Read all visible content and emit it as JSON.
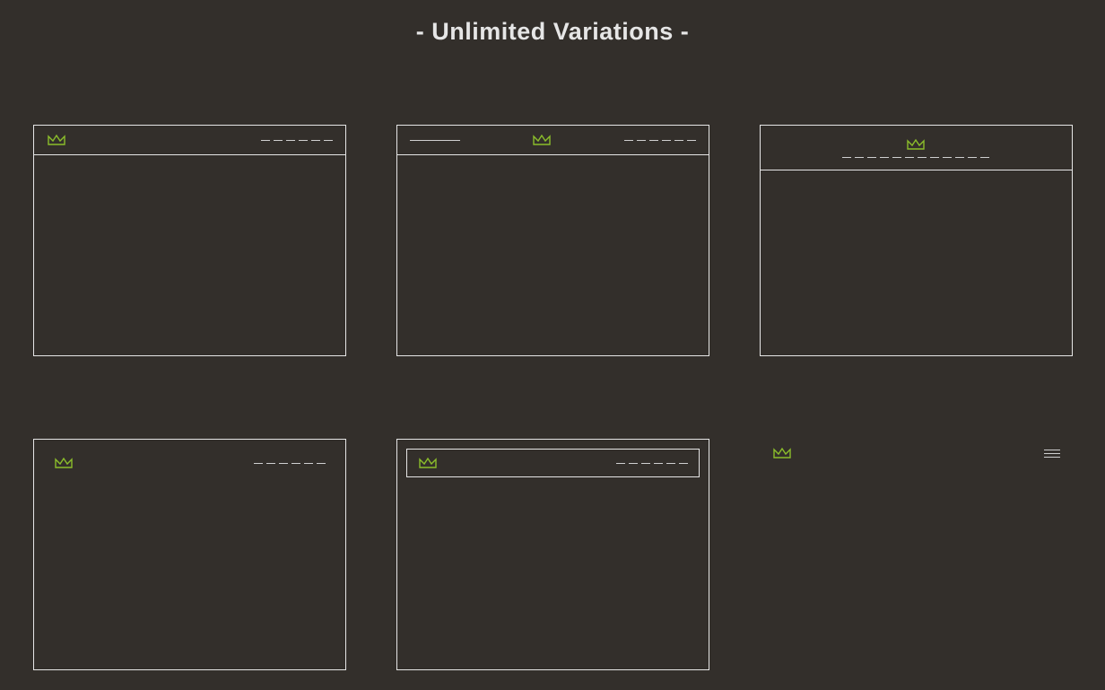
{
  "title": "- Unlimited Variations -",
  "icons": {
    "crown": "crown-icon",
    "hamburger": "hamburger-icon"
  },
  "colors": {
    "background": "#332f2b",
    "border": "#e6e6e6",
    "accent": "#8bbd2b",
    "dash": "#cfcfcf"
  },
  "cards": [
    {
      "layout": "logo-left-menu-right-bordered"
    },
    {
      "layout": "search-left-logo-center-menu-right-bordered"
    },
    {
      "layout": "logo-center-menu-below-bordered"
    },
    {
      "layout": "logo-left-menu-right-floating"
    },
    {
      "layout": "inset-bordered-header"
    },
    {
      "layout": "logo-left-hamburger-right-borderless"
    }
  ]
}
